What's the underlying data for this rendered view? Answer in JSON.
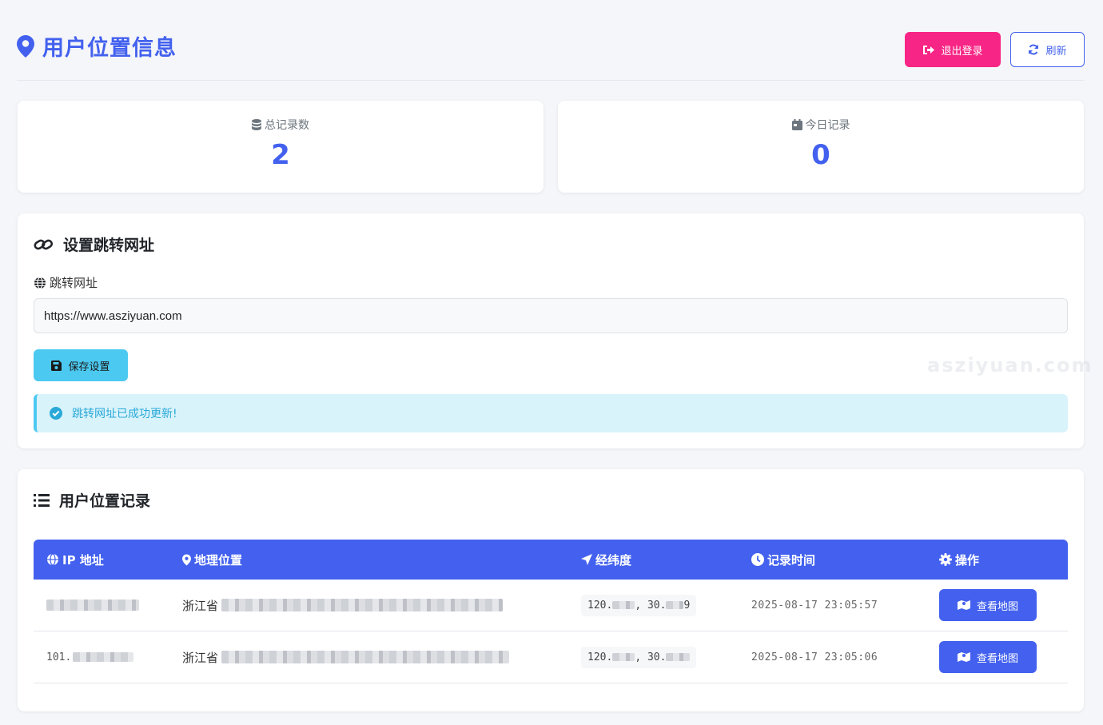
{
  "header": {
    "title": "用户位置信息",
    "logout_label": "退出登录",
    "refresh_label": "刷新"
  },
  "stats": [
    {
      "label": "总记录数",
      "value": "2"
    },
    {
      "label": "今日记录",
      "value": "0"
    }
  ],
  "settings": {
    "title": "设置跳转网址",
    "field_label": "跳转网址",
    "url_value": "https://www.asziyuan.com",
    "save_label": "保存设置",
    "alert": "跳转网址已成功更新!"
  },
  "watermark": "asziyuan.com",
  "records": {
    "title": "用户位置记录",
    "columns": [
      "IP 地址",
      "地理位置",
      "经纬度",
      "记录时间",
      "操作"
    ],
    "rows": [
      {
        "ip": "",
        "location": "浙江省",
        "coords_lng": "120.",
        "coords_lat": "30.",
        "coords_lat_suffix": "9",
        "time": "2025-08-17 23:05:57",
        "action": "查看地图"
      },
      {
        "ip": "101.",
        "location": "浙江省",
        "coords_lng": "120.",
        "coords_lat": "30.",
        "coords_lat_suffix": "",
        "time": "2025-08-17 23:05:06",
        "action": "查看地图"
      }
    ]
  },
  "colors": {
    "primary": "#4361ee",
    "danger": "#f72585",
    "info": "#4cc9f0",
    "background": "#f5f6fa"
  }
}
